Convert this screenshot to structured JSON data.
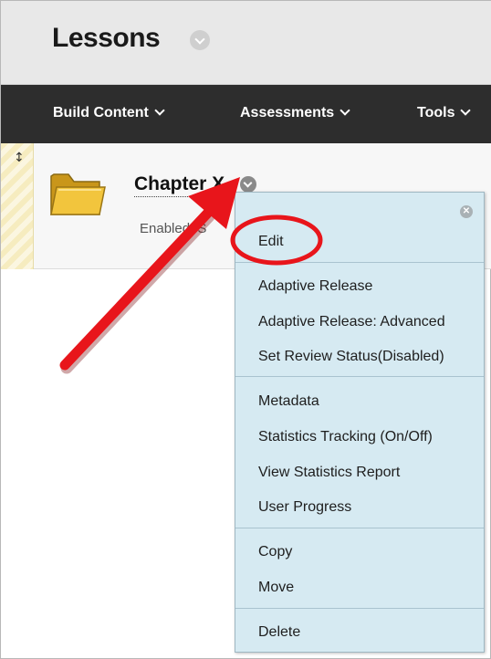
{
  "page": {
    "title": "Lessons"
  },
  "toolbar": {
    "build_content": "Build Content",
    "assessments": "Assessments",
    "tools": "Tools"
  },
  "content_item": {
    "title": "Chapter X",
    "status": "Enabled: S"
  },
  "context_menu": {
    "items": [
      "Edit",
      "Adaptive Release",
      "Adaptive Release: Advanced",
      "Set Review Status(Disabled)",
      "Metadata",
      "Statistics Tracking (On/Off)",
      "View Statistics Report",
      "User Progress",
      "Copy",
      "Move",
      "Delete"
    ]
  },
  "colors": {
    "toolbar_bg": "#2d2d2d",
    "menu_bg": "#d6eaf2",
    "annotation_red": "#e8151b"
  },
  "icons": [
    "chevron-down-icon",
    "drag-handle-icon",
    "folder-icon",
    "close-icon"
  ]
}
